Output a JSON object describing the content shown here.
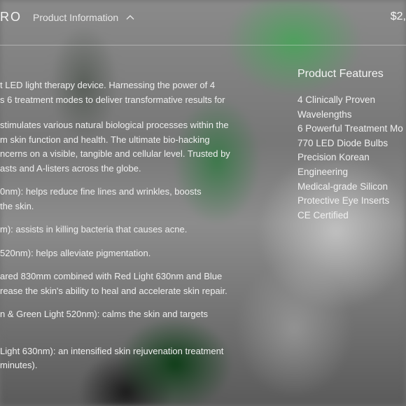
{
  "header": {
    "brand": "RO",
    "tab_label": "Product Information",
    "tab_icon": "chevron-up-icon",
    "price": "$2,"
  },
  "description": [
    "t LED light therapy device. Harnessing the power of 4",
    "s 6 treatment modes to deliver transformative results for",
    "stimulates various natural biological processes within the",
    "m skin function and health. The ultimate bio-hacking",
    "ncerns on a visible, tangible and cellular level. Trusted by",
    "asts and A-listers across the globe.",
    "0nm): helps reduce fine lines and wrinkles, boosts",
    "the skin.",
    "m): assists in killing bacteria that causes acne.",
    "520nm): helps alleviate pigmentation.",
    "ared 830mm combined with Red Light 630nm and Blue",
    "rease the skin's ability to heal and accelerate skin repair.",
    "n & Green Light 520nm): calms the skin and targets",
    " Light 630nm): an intensified skin rejuvenation treatment",
    " minutes)."
  ],
  "features": {
    "title": "Product Features",
    "items": [
      "4 Clinically Proven",
      "Wavelengths",
      "6 Powerful Treatment Mo",
      "770 LED Diode Bulbs",
      "Precision Korean",
      "Engineering",
      "Medical-grade Silicon",
      "Protective Eye Inserts",
      "CE Certified"
    ]
  }
}
